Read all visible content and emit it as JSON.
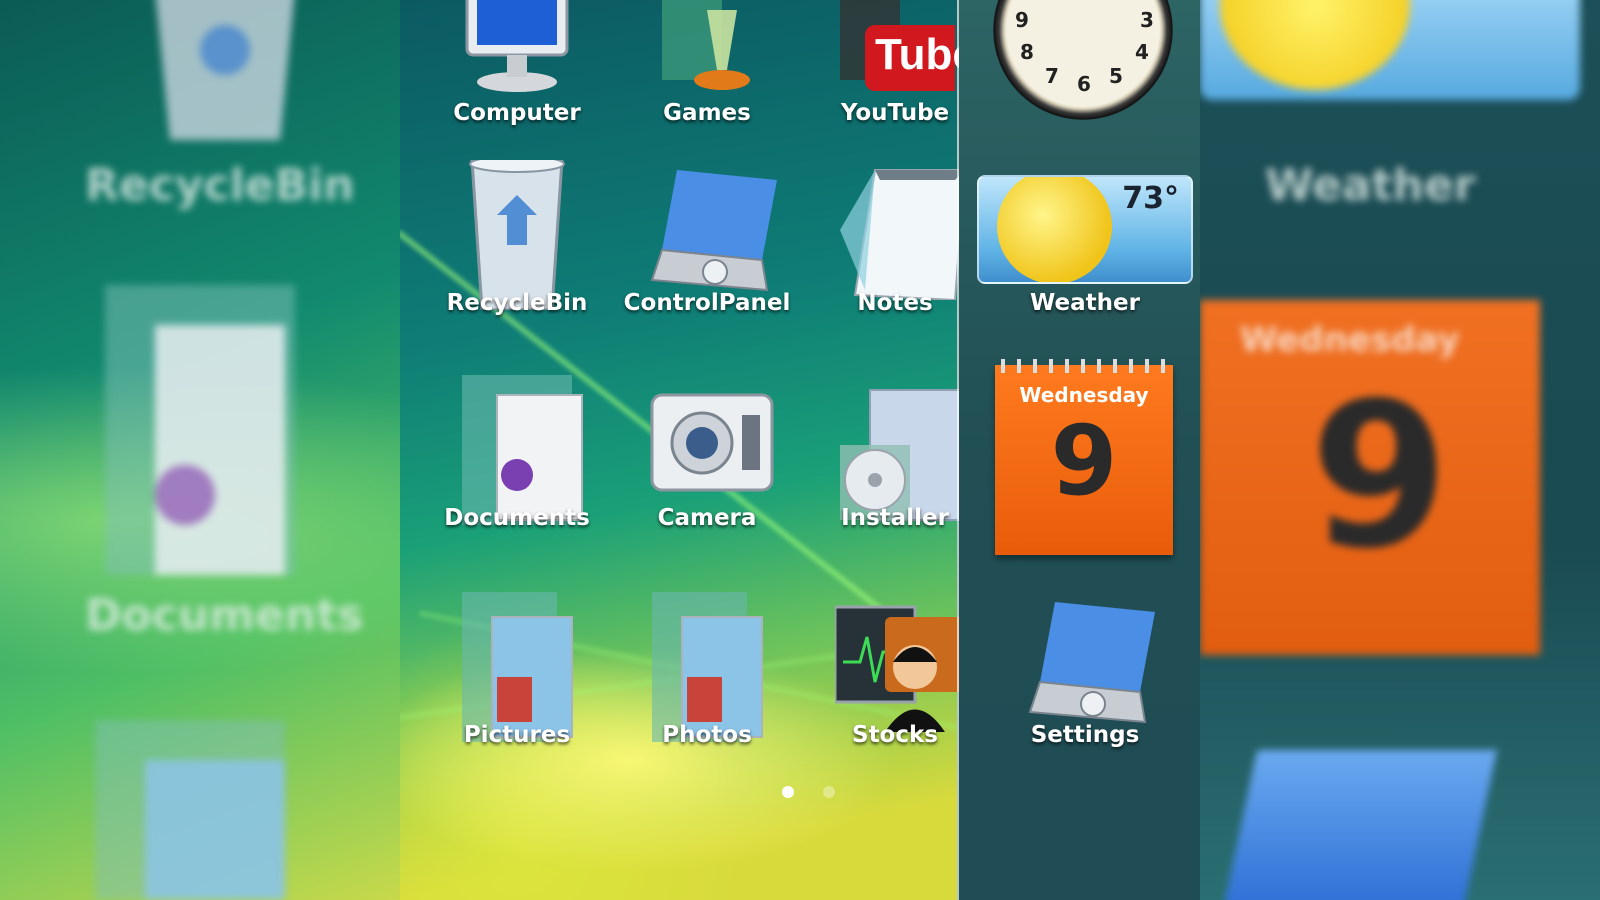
{
  "backdrop_left": {
    "labels": [
      "RecycleBin",
      "Documents"
    ]
  },
  "backdrop_right": {
    "weather_label": "Weather",
    "calendar_day": "Wednesday",
    "calendar_date": "9"
  },
  "apps": [
    {
      "label": "Computer",
      "icon": "computer-icon"
    },
    {
      "label": "Games",
      "icon": "games-icon"
    },
    {
      "label": "YouTube",
      "icon": "youtube-icon"
    },
    {
      "label": "RecycleBin",
      "icon": "recycle-bin-icon"
    },
    {
      "label": "ControlPanel",
      "icon": "control-panel-icon"
    },
    {
      "label": "Notes",
      "icon": "notes-icon"
    },
    {
      "label": "Documents",
      "icon": "documents-folder-icon"
    },
    {
      "label": "Camera",
      "icon": "camera-icon"
    },
    {
      "label": "Installer",
      "icon": "installer-icon"
    },
    {
      "label": "Pictures",
      "icon": "pictures-folder-icon"
    },
    {
      "label": "Photos",
      "icon": "photos-folder-icon"
    },
    {
      "label": "Stocks",
      "icon": "stocks-icon"
    }
  ],
  "youtube_badge": "Tube",
  "dock": {
    "weather": {
      "label": "Weather",
      "temperature": "73°"
    },
    "calendar": {
      "day": "Wednesday",
      "date": "9"
    },
    "settings": {
      "label": "Settings"
    },
    "clock_numbers": [
      "9",
      "3",
      "8",
      "4",
      "7",
      "6",
      "5"
    ]
  },
  "page_indicator": {
    "pages": 2,
    "current": 1
  },
  "colors": {
    "calendar": "#e85c0a",
    "youtube_red": "#d0181e",
    "label_text": "#ffffff"
  }
}
